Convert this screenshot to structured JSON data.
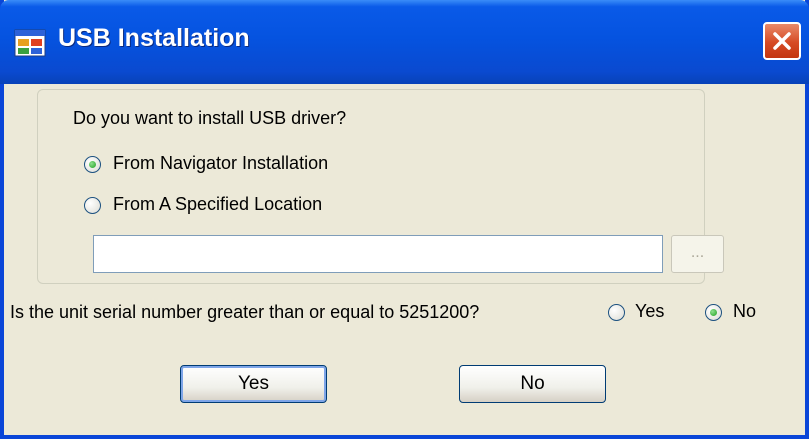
{
  "window": {
    "title": "USB Installation"
  },
  "group": {
    "question": "Do you want to install USB driver?",
    "options": [
      {
        "label": "From Navigator Installation",
        "selected": true
      },
      {
        "label": "From A Specified Location",
        "selected": false
      }
    ],
    "path_value": "",
    "browse_label": "..."
  },
  "serial": {
    "question": "Is the unit serial number greater than or equal to 5251200?",
    "yes_label": "Yes",
    "no_label": "No",
    "selected": "No"
  },
  "buttons": {
    "yes_label": "Yes",
    "no_label": "No"
  },
  "colors": {
    "titlebar": "#0553e0",
    "dialog_bg": "#ece9d8",
    "close_button": "#d64a24",
    "radio_dot": "#21a121"
  }
}
